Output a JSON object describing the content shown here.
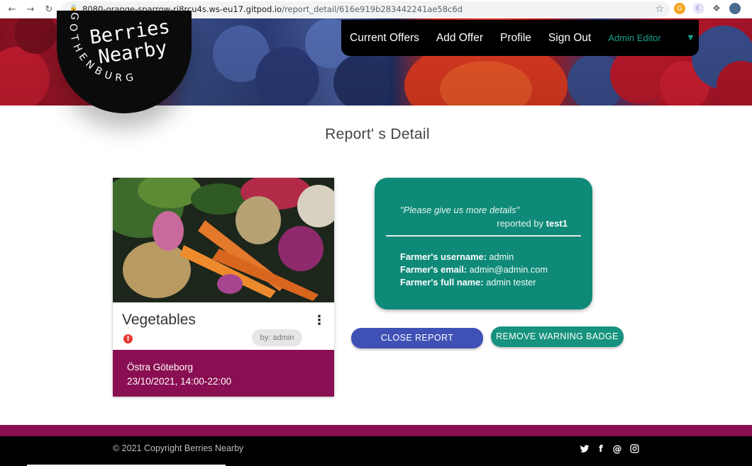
{
  "browser": {
    "url_domain": "8080-orange-sparrow-rj8rcu4s.ws-eu17.gitpod.io",
    "url_path": "/report_detail/616e919b283442241ae58c6d"
  },
  "header": {
    "logo_title_line1": "Berries",
    "logo_title_line2": "Nearby",
    "logo_city": "GOTHENBURG",
    "nav": {
      "current_offers": "Current Offers",
      "add_offer": "Add Offer",
      "profile": "Profile",
      "sign_out": "Sign Out",
      "admin": "Admin Editor"
    }
  },
  "page_title": "Report' s Detail",
  "offer_card": {
    "title": "Vegetables",
    "warning_symbol": "!",
    "by": "by: admin",
    "location": "Östra Göteborg",
    "datetime": "23/10/2021, 14:00-22:00"
  },
  "report": {
    "message": "\"Please give us more details\"",
    "reported_by_label": "reported by",
    "reported_by_user": "test1",
    "farmer_username_label": "Farmer's username:",
    "farmer_username": "admin",
    "farmer_email_label": "Farmer's email:",
    "farmer_email": "admin@admin.com",
    "farmer_fullname_label": "Farmer's full name:",
    "farmer_fullname": "admin tester"
  },
  "buttons": {
    "close_report": "CLOSE REPORT",
    "remove_warning": "REMOVE WARNING BADGE"
  },
  "footer": {
    "copyright": "© 2021 Copyright Berries Nearby",
    "social_icons": [
      "twitter-icon",
      "facebook-icon",
      "at-email-icon",
      "instagram-icon"
    ]
  },
  "colors": {
    "accent_teal": "#0f8a78",
    "brand_maroon": "#8a0e52",
    "button_blue": "#3f51b5"
  }
}
